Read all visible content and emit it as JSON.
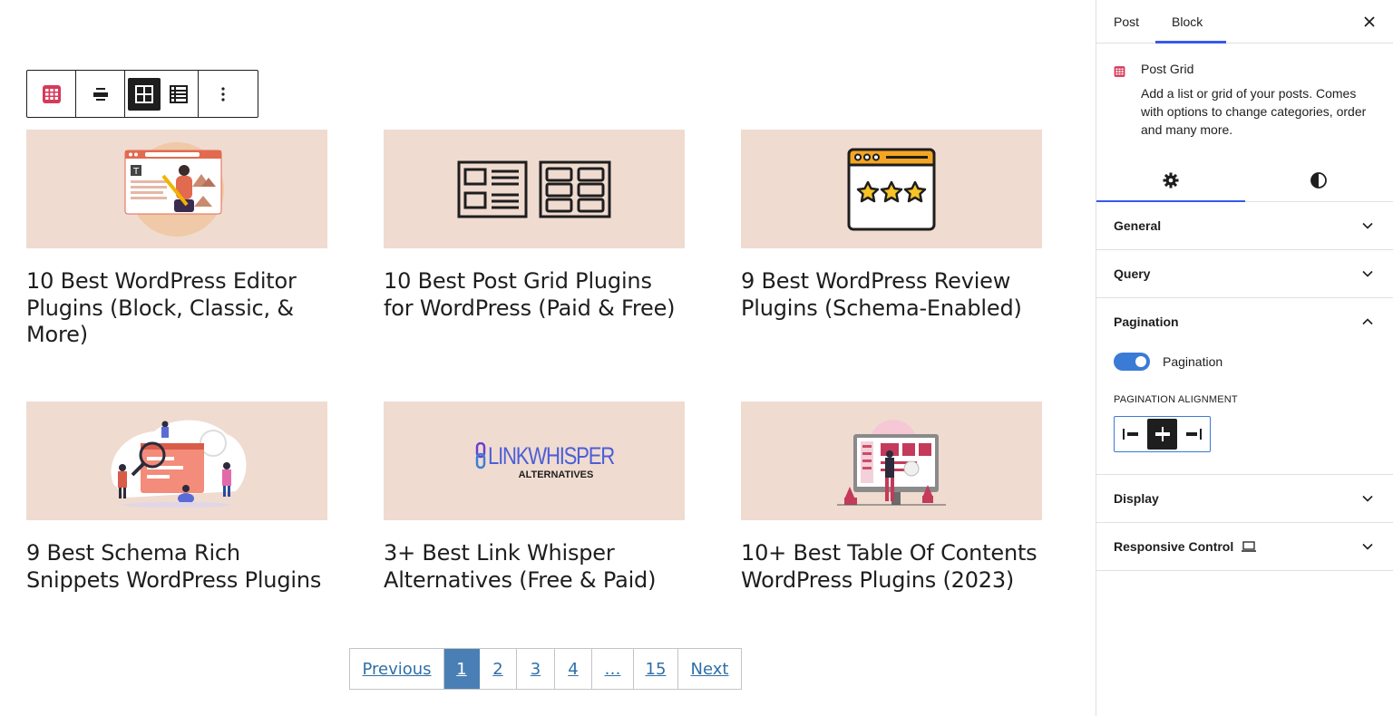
{
  "toolbar": {
    "block_icon": "post-grid-icon",
    "align_icon": "align-icon",
    "grid_view_icon": "grid-view-icon",
    "list_view_icon": "list-view-icon",
    "more_icon": "more-options-icon"
  },
  "posts": [
    {
      "title": "10 Best WordPress Editor Plugins (Block, Classic, & More)",
      "image": "editor-illustration"
    },
    {
      "title": "10 Best Post Grid Plugins for WordPress (Paid & Free)",
      "image": "grid-layout-illustration"
    },
    {
      "title": "9 Best WordPress Review Plugins (Schema-Enabled)",
      "image": "review-stars-illustration"
    },
    {
      "title": "9 Best Schema Rich Snippets WordPress Plugins",
      "image": "schema-team-illustration"
    },
    {
      "title": "3+ Best Link Whisper Alternatives (Free & Paid)",
      "image": "link-whisper-logo",
      "logo_text": "LINKWHISPER",
      "logo_sub": "ALTERNATIVES"
    },
    {
      "title": "10+ Best Table Of Contents WordPress Plugins (2023)",
      "image": "toc-illustration"
    }
  ],
  "pagination": {
    "previous": "Previous",
    "pages": [
      "1",
      "2",
      "3",
      "4",
      "…",
      "15"
    ],
    "current": "1",
    "next": "Next"
  },
  "sidebar": {
    "tabs": [
      "Post",
      "Block"
    ],
    "active_tab": "Block",
    "block": {
      "title": "Post Grid",
      "description": "Add a list or grid of your posts. Comes with options to change categories, order and many more."
    },
    "subtabs": [
      "settings-gear-icon",
      "styles-contrast-icon"
    ],
    "panels": {
      "general": "General",
      "query": "Query",
      "pagination": "Pagination",
      "display": "Display",
      "responsive": "Responsive Control"
    },
    "pagination_toggle_label": "Pagination",
    "pagination_toggle_on": true,
    "alignment_label": "Pagination Alignment",
    "alignment_selected": "center"
  },
  "colors": {
    "accent": "#3858e9",
    "toggle": "#3a7bd5",
    "thumb_bg": "#f0dbd0",
    "pagination_current": "#4a7fb5",
    "link": "#2f6fa8",
    "block_icon": "#d63a5a"
  }
}
